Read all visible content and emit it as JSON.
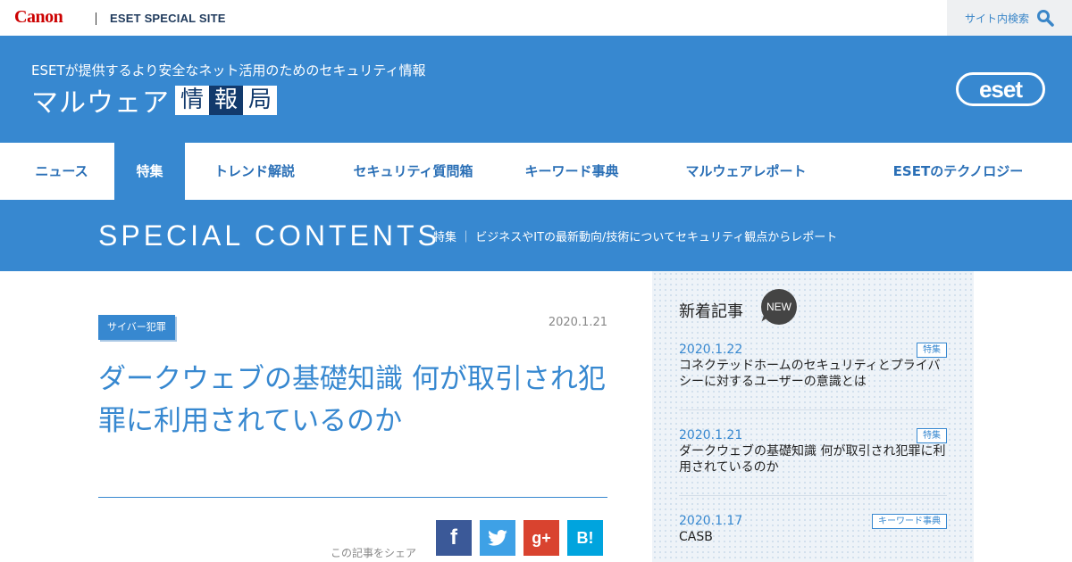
{
  "topbar": {
    "logo_text": "Canon",
    "site_name": "ESET SPECIAL SITE",
    "search_label": "サイト内検索"
  },
  "header": {
    "tagline": "ESETが提供するより安全なネット活用のためのセキュリティ情報",
    "brand_main": "マルウェア",
    "brand_chars": [
      "情",
      "報",
      "局"
    ],
    "logo_text": "eset"
  },
  "nav": {
    "items": [
      {
        "label": "ニュース",
        "active": false
      },
      {
        "label": "特集",
        "active": true
      },
      {
        "label": "トレンド解説",
        "active": false
      },
      {
        "label": "セキュリティ質問箱",
        "active": false
      },
      {
        "label": "キーワード事典",
        "active": false
      },
      {
        "label": "マルウェアレポート",
        "active": false
      },
      {
        "label": "ESETのテクノロジー",
        "active": false
      }
    ]
  },
  "banner": {
    "title": "SPECIAL CONTENTS",
    "description": "特集 ｜ ビジネスやITの最新動向/技術についてセキュリティ観点からレポート"
  },
  "article": {
    "category": "サイバー犯罪",
    "date": "2020.1.21",
    "title": "ダークウェブの基礎知識 何が取引され犯罪に利用されているのか",
    "share_label": "この記事をシェア",
    "share_buttons": [
      {
        "name": "facebook",
        "glyph": "f"
      },
      {
        "name": "twitter",
        "glyph": "t"
      },
      {
        "name": "google-plus",
        "glyph": "g+"
      },
      {
        "name": "hatena-bookmark",
        "glyph": "B!"
      }
    ]
  },
  "sidebar": {
    "heading": "新着記事",
    "new_badge": "NEW",
    "items": [
      {
        "date": "2020.1.22",
        "tag": "特集",
        "title": "コネクテッドホームのセキュリティとプライバシーに対するユーザーの意識とは"
      },
      {
        "date": "2020.1.21",
        "tag": "特集",
        "title": "ダークウェブの基礎知識 何が取引され犯罪に利用されているのか"
      },
      {
        "date": "2020.1.17",
        "tag": "キーワード事典",
        "title": "CASB"
      }
    ]
  },
  "colors": {
    "brand_blue": "#3788d0",
    "canon_red": "#cc0000",
    "navy": "#123a6c",
    "facebook": "#3b5998",
    "twitter": "#3ea1e6",
    "google_plus": "#d9432f",
    "hatena": "#00a4de"
  }
}
